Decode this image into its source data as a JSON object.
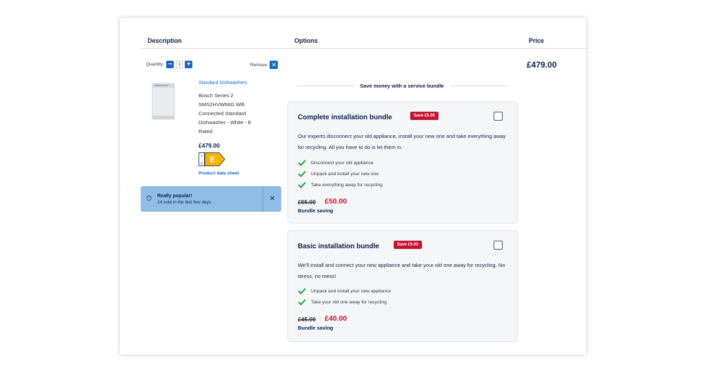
{
  "headers": {
    "description": "Description",
    "options": "Options",
    "price": "Price"
  },
  "quantity": {
    "label": "Quantity",
    "value": "1",
    "minus": "−",
    "plus": "+"
  },
  "remove": {
    "label": "Remove",
    "icon": "close-icon"
  },
  "product": {
    "category": "Standard Dishwashers",
    "title": "Bosch Series 2 SMS2HVW66G Wifi Connected Standard Dishwasher - White - E Rated",
    "price": "£479.00",
    "energy_rating": "E",
    "energy_scale_top": "A",
    "energy_scale_bottom": "G",
    "datasheet_link": "Product data sheet"
  },
  "popular": {
    "title": "Really popular!",
    "text": "14 sold in the last few days",
    "icon": "timer-icon"
  },
  "bundle_header": "Save money with a service bundle",
  "bundles": [
    {
      "title": "Complete installation bundle",
      "badge": "Save £5.00",
      "description": "Our experts disconnect your old appliance, install your new one and take everything away for recycling. All you have to do is let them in.",
      "features": [
        "Disconnect your old appliance",
        "Unpack and install your new one",
        "Take everything away for recycling"
      ],
      "old_price": "£55.00",
      "new_price": "£50.00",
      "saving_label": "Bundle saving"
    },
    {
      "title": "Basic installation bundle",
      "badge": "Save £5.00",
      "description": "We'll install and connect your new appliance and take your old one away for recycling. No stress, no mess!",
      "features": [
        "Unpack and install your new appliance",
        "Take your old one away for recycling"
      ],
      "old_price": "£45.00",
      "new_price": "£40.00",
      "saving_label": "Bundle saving"
    }
  ],
  "line_price": "£479.00",
  "colors": {
    "navy": "#0b1f4a",
    "blue": "#1766c9",
    "red": "#c4122f",
    "green": "#1fa33a",
    "popular_bg": "#8fbde6"
  }
}
